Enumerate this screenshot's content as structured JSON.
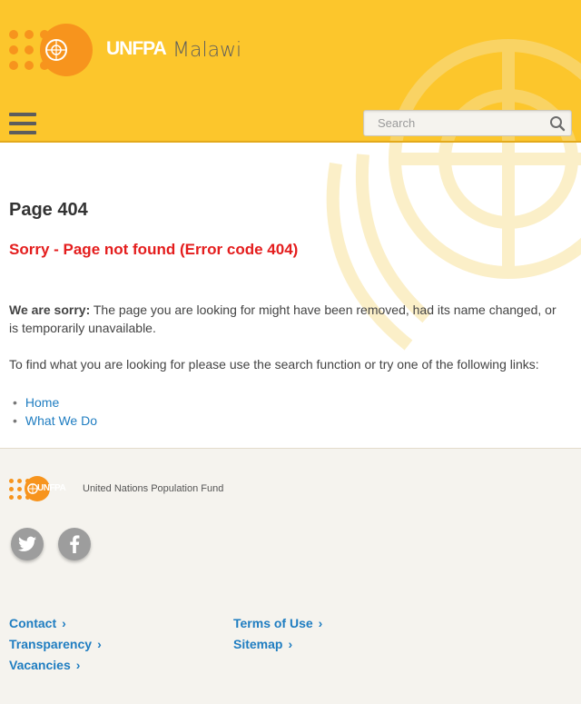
{
  "header": {
    "brand_word": "UNFPA",
    "brand_country": "Malawi",
    "search": {
      "placeholder": "Search"
    }
  },
  "main": {
    "page_title": "Page 404",
    "error_title": "Sorry - Page not found (Error code 404)",
    "sorry_label": "We are sorry:",
    "sorry_text": " The page you are looking for might have been removed, had its name changed, or is temporarily unavailable.",
    "find_text": "To find what you are looking for please use the search function or try one of the following links:",
    "links": [
      "Home",
      "What We Do"
    ]
  },
  "footer": {
    "brand_word": "UNFPA",
    "org_name": "United Nations Population Fund",
    "links_col1": [
      "Contact",
      "Transparency",
      "Vacancies"
    ],
    "links_col2": [
      "Terms of Use",
      "Sitemap"
    ]
  },
  "colors": {
    "header_bg": "#fcc62c",
    "brand_orange": "#f7941d",
    "error_red": "#e41d1d",
    "link_blue": "#1f7dc1"
  }
}
